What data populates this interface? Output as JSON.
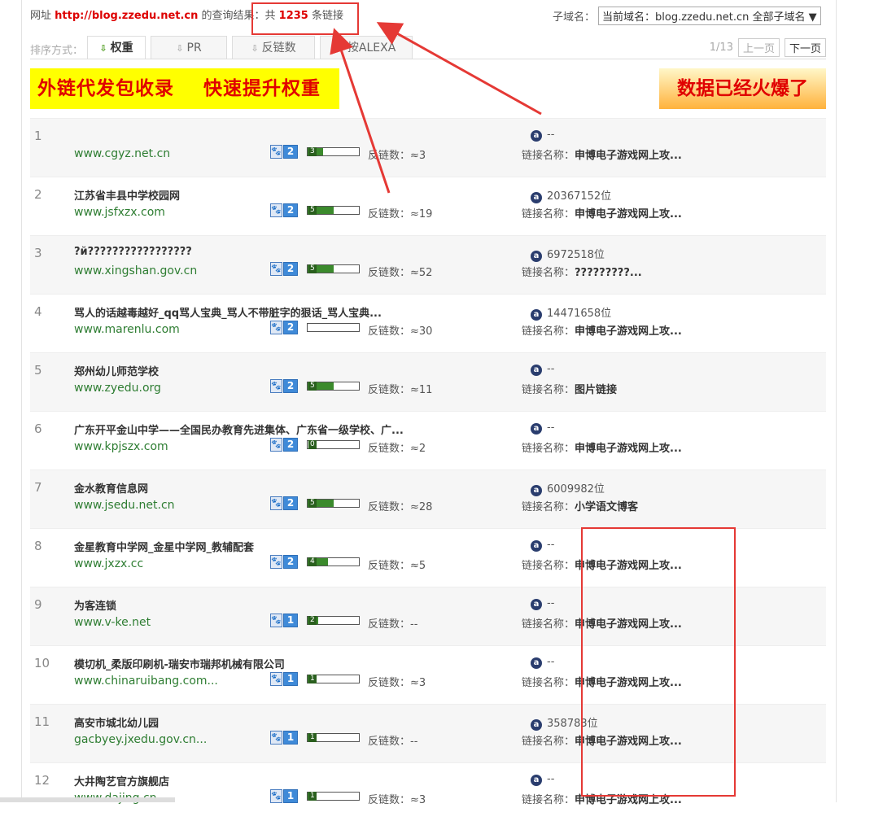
{
  "header": {
    "prefix": "网址 ",
    "domain": "http://blog.zzedu.net.cn",
    "mid": " 的查询结果：共 ",
    "count": "1235",
    "suffix": " 条链接",
    "subdomain_label": "子域名：",
    "subdomain_value": "当前域名：blog.zzedu.net.cn 全部子域名 ▼"
  },
  "sort": {
    "label": "排序方式：",
    "tabs": [
      {
        "label": "权重",
        "arrow": "⇩"
      },
      {
        "label": "PR",
        "arrow": "⇩"
      },
      {
        "label": "反链数",
        "arrow": "⇩"
      },
      {
        "label": "按ALEXA",
        "arrow": "⇩"
      }
    ]
  },
  "pager": {
    "page": "1/13",
    "prev": "上一页",
    "next": "下一页"
  },
  "banners": {
    "left": " 外链代发包收录    快速提升权重",
    "right": "数据已经火爆了"
  },
  "labels": {
    "links_prefix": "反链数：",
    "alexa_icon": "a",
    "link_name_prefix": "链接名称："
  },
  "rows": [
    {
      "num": "1",
      "title": "",
      "url": "www.cgyz.net.cn",
      "br": "2",
      "pr": "3",
      "pr_level": 0.3,
      "links": "≈3",
      "alexa": "--",
      "link_name": "申博电子游戏网上攻..."
    },
    {
      "num": "2",
      "title": "江苏省丰县中学校园网",
      "url": "www.jsfxzx.com",
      "br": "2",
      "pr": "5",
      "pr_level": 0.5,
      "links": "≈19",
      "alexa": "20367152位",
      "link_name": "申博电子游戏网上攻..."
    },
    {
      "num": "3",
      "title": "?й?????????????????",
      "url": "www.xingshan.gov.cn",
      "br": "2",
      "pr": "5",
      "pr_level": 0.5,
      "links": "≈52",
      "alexa": "6972518位",
      "link_name": "?????????..."
    },
    {
      "num": "4",
      "title": "骂人的话越毒越好_qq骂人宝典_骂人不带脏字的狠话_骂人宝典...",
      "url": "www.marenlu.com",
      "br": "2",
      "pr": "",
      "pr_level": 0,
      "links": "≈30",
      "alexa": "14471658位",
      "link_name": "申博电子游戏网上攻..."
    },
    {
      "num": "5",
      "title": "郑州幼儿师范学校",
      "url": "www.zyedu.org",
      "br": "2",
      "pr": "5",
      "pr_level": 0.5,
      "links": "≈11",
      "alexa": "--",
      "link_name": "图片链接"
    },
    {
      "num": "6",
      "title": "广东开平金山中学——全国民办教育先进集体、广东省一级学校、广...",
      "url": "www.kpjszx.com",
      "br": "2",
      "pr": "0",
      "pr_level": 0,
      "links": "≈2",
      "alexa": "--",
      "link_name": "申博电子游戏网上攻..."
    },
    {
      "num": "7",
      "title": "金水教育信息网",
      "url": "www.jsedu.net.cn",
      "br": "2",
      "pr": "5",
      "pr_level": 0.5,
      "links": "≈28",
      "alexa": "6009982位",
      "link_name": "小学语文博客"
    },
    {
      "num": "8",
      "title": "金星教育中学网_金星中学网_教辅配套",
      "url": "www.jxzx.cc",
      "br": "2",
      "pr": "4",
      "pr_level": 0.4,
      "links": "≈5",
      "alexa": "--",
      "link_name": "申博电子游戏网上攻..."
    },
    {
      "num": "9",
      "title": "为客连锁",
      "url": "www.v-ke.net",
      "br": "1",
      "pr": "2",
      "pr_level": 0.2,
      "links": "--",
      "alexa": "--",
      "link_name": "申博电子游戏网上攻..."
    },
    {
      "num": "10",
      "title": "模切机_柔版印刷机-瑞安市瑞邦机械有限公司",
      "url": "www.chinaruibang.com...",
      "br": "1",
      "pr": "1",
      "pr_level": 0.1,
      "links": "≈3",
      "alexa": "--",
      "link_name": "申博电子游戏网上攻..."
    },
    {
      "num": "11",
      "title": "高安市城北幼儿园",
      "url": "gacbyey.jxedu.gov.cn...",
      "br": "1",
      "pr": "1",
      "pr_level": 0.1,
      "links": "--",
      "alexa": "358783位",
      "link_name": "申博电子游戏网上攻..."
    },
    {
      "num": "12",
      "title": "大井陶艺官方旗舰店",
      "url": "www.dajing.cn",
      "br": "1",
      "pr": "1",
      "pr_level": 0.1,
      "links": "≈3",
      "alexa": "--",
      "link_name": "申博电子游戏网上攻..."
    }
  ],
  "colors": {
    "accent_red": "#e53935",
    "url_green": "#2e7d32",
    "banner_yellow": "#ffff00"
  }
}
